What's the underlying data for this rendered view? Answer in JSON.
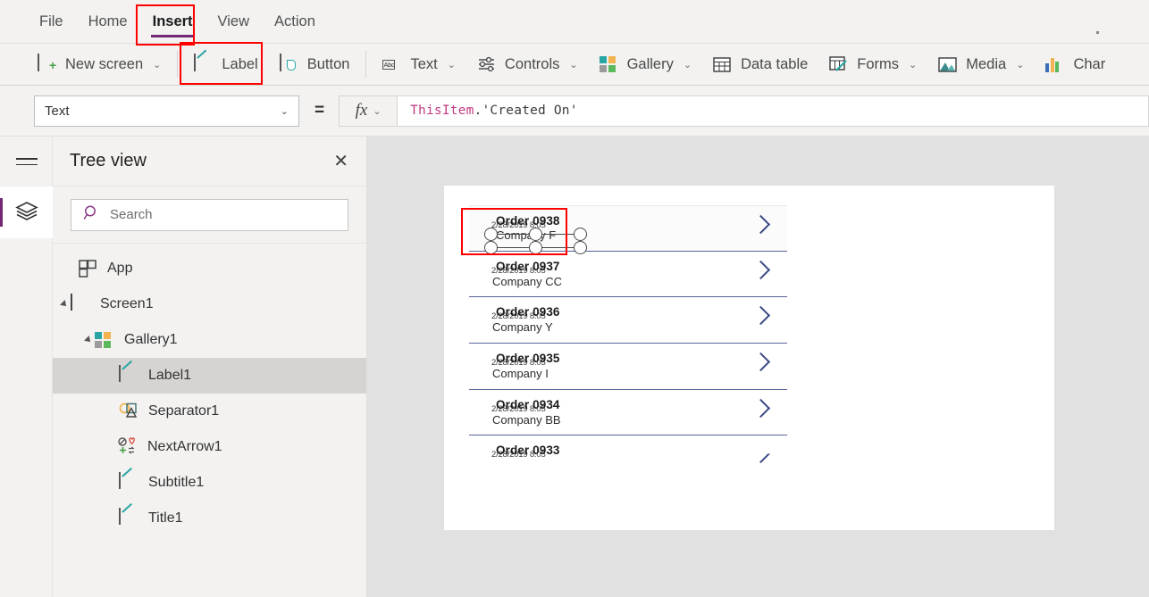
{
  "menu": {
    "items": [
      {
        "label": "File",
        "active": false
      },
      {
        "label": "Home",
        "active": false
      },
      {
        "label": "Insert",
        "active": true
      },
      {
        "label": "View",
        "active": false
      },
      {
        "label": "Action",
        "active": false
      }
    ],
    "accent_color": "#742774"
  },
  "ribbon": {
    "items": [
      {
        "label": "New screen",
        "icon": "new-screen-icon",
        "caret": "⌄"
      },
      {
        "label": "Label",
        "icon": "label-icon",
        "caret": ""
      },
      {
        "label": "Button",
        "icon": "button-icon",
        "caret": ""
      },
      {
        "label": "Text",
        "icon": "text-icon",
        "caret": "⌄"
      },
      {
        "label": "Controls",
        "icon": "controls-icon",
        "caret": "⌄"
      },
      {
        "label": "Gallery",
        "icon": "gallery-icon",
        "caret": "⌄"
      },
      {
        "label": "Data table",
        "icon": "data-table-icon",
        "caret": ""
      },
      {
        "label": "Forms",
        "icon": "forms-icon",
        "caret": "⌄"
      },
      {
        "label": "Media",
        "icon": "media-icon",
        "caret": "⌄"
      },
      {
        "label": "Char",
        "icon": "charts-icon",
        "caret": ""
      }
    ]
  },
  "formula_bar": {
    "property": "Text",
    "equals": "=",
    "fx_label": "fx",
    "fx_caret": "⌄",
    "formula_token_object": "ThisItem",
    "formula_token_rest": ".'Created On'"
  },
  "tree_view": {
    "title": "Tree view",
    "close_label": "✕",
    "search_placeholder": "Search",
    "items": [
      {
        "label": "App",
        "icon": "app-icon",
        "depth": 0,
        "caret": false,
        "selected": false
      },
      {
        "label": "Screen1",
        "icon": "screen-icon",
        "depth": 0,
        "caret": true,
        "selected": false
      },
      {
        "label": "Gallery1",
        "icon": "gallery-icon",
        "depth": 1,
        "caret": true,
        "selected": false
      },
      {
        "label": "Label1",
        "icon": "label-icon",
        "depth": 2,
        "caret": false,
        "selected": true
      },
      {
        "label": "Separator1",
        "icon": "separator-icon",
        "depth": 2,
        "caret": false,
        "selected": false
      },
      {
        "label": "NextArrow1",
        "icon": "next-arrow-icon",
        "depth": 2,
        "caret": false,
        "selected": false
      },
      {
        "label": "Subtitle1",
        "icon": "label-icon",
        "depth": 2,
        "caret": false,
        "selected": false
      },
      {
        "label": "Title1",
        "icon": "label-icon",
        "depth": 2,
        "caret": false,
        "selected": false
      }
    ]
  },
  "canvas": {
    "gallery_rows": [
      {
        "title": "Order 0938",
        "date": "2/28/2019 8:05",
        "subtitle": "Company F",
        "selected": true
      },
      {
        "title": "Order 0937",
        "date": "2/28/2019 8:05",
        "subtitle": "Company CC",
        "selected": false
      },
      {
        "title": "Order 0936",
        "date": "2/28/2019 8:05",
        "subtitle": "Company Y",
        "selected": false
      },
      {
        "title": "Order 0935",
        "date": "2/28/2019 8:05",
        "subtitle": "Company I",
        "selected": false
      },
      {
        "title": "Order 0934",
        "date": "2/28/2019 8:05",
        "subtitle": "Company BB",
        "selected": false
      },
      {
        "title": "Order 0933",
        "date": "2/28/2019 8:05",
        "subtitle": "",
        "selected": false
      }
    ],
    "chevron_color": "#3b4a86",
    "screen_background": "#ffffff",
    "canvas_background": "#e1e1e1"
  },
  "annotations": {
    "highlight_color": "#ff0000",
    "targets": [
      "insert-tab",
      "label-ribbon-button",
      "selected-label-control"
    ]
  }
}
